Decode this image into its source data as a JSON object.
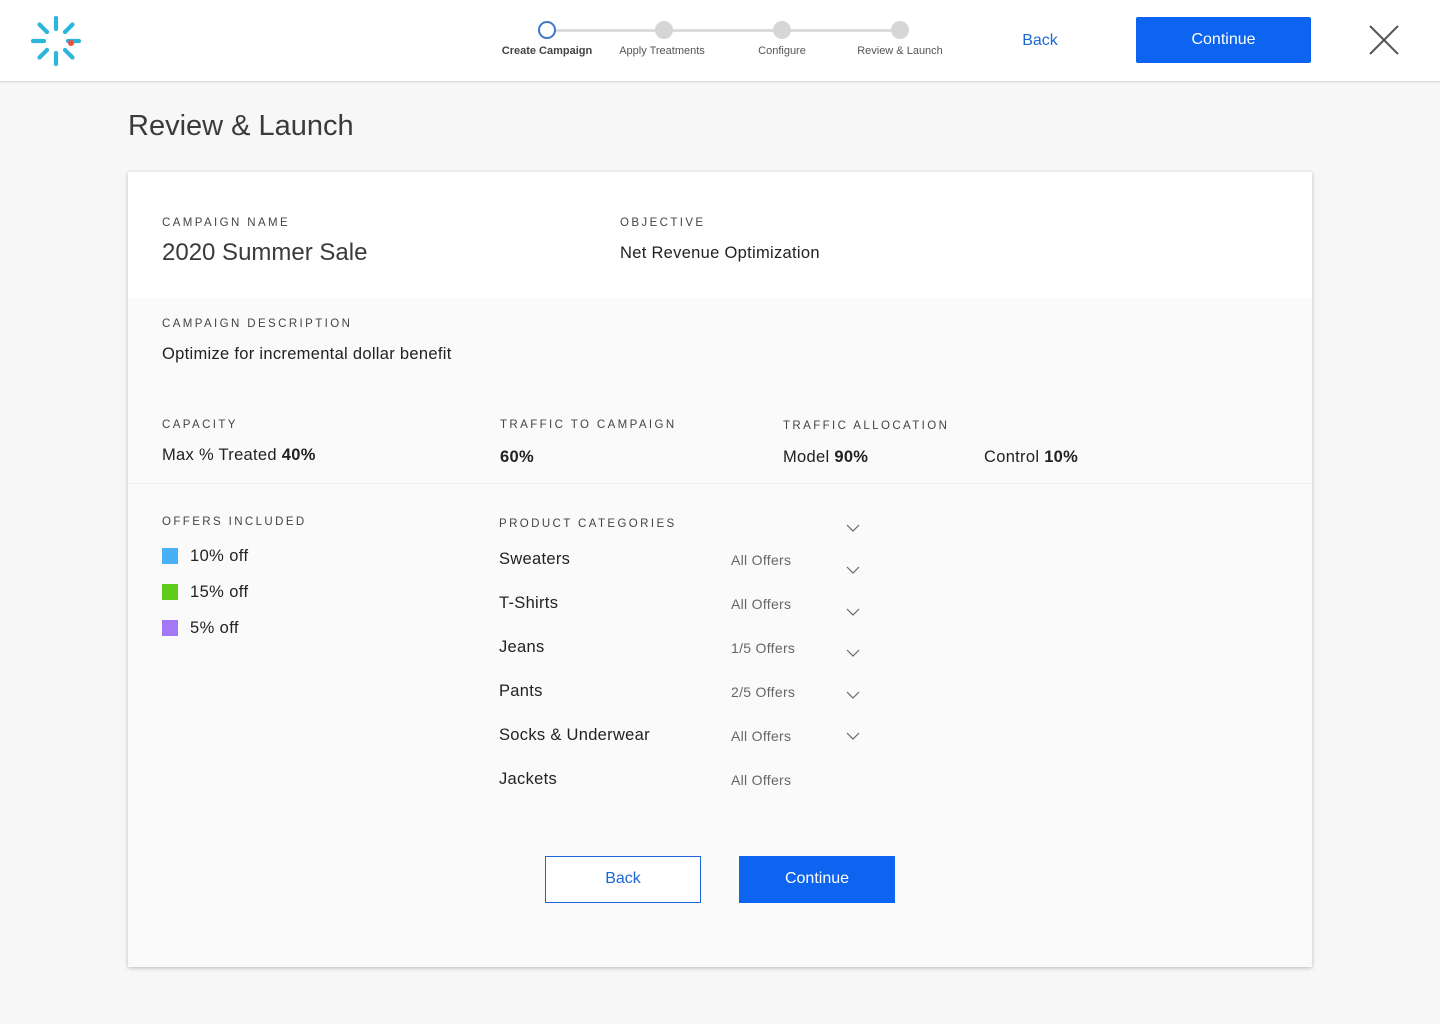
{
  "header": {
    "steps": [
      {
        "label": "Create Campaign",
        "active": true
      },
      {
        "label": "Apply Treatments",
        "active": false
      },
      {
        "label": "Configure",
        "active": false
      },
      {
        "label": "Review & Launch",
        "active": false
      }
    ],
    "back_label": "Back",
    "continue_label": "Continue"
  },
  "page": {
    "title": "Review & Launch"
  },
  "campaign": {
    "name_label": "CAMPAIGN NAME",
    "name": "2020 Summer Sale",
    "objective_label": "OBJECTIVE",
    "objective": "Net Revenue Optimization",
    "description_label": "CAMPAIGN DESCRIPTION",
    "description": "Optimize for incremental dollar benefit",
    "capacity_label": "CAPACITY",
    "capacity_text": "Max % Treated",
    "capacity_value": "40%",
    "traffic_label": "TRAFFIC TO CAMPAIGN",
    "traffic_value": "60%",
    "allocation_label": "TRAFFIC ALLOCATION",
    "model_text": "Model",
    "model_value": "90%",
    "control_text": "Control",
    "control_value": "10%"
  },
  "offers": {
    "label": "OFFERS INCLUDED",
    "items": [
      {
        "label": "10% off",
        "color": "#4ab0f5"
      },
      {
        "label": "15% off",
        "color": "#5fcb1a"
      },
      {
        "label": "5% off",
        "color": "#a478f5"
      }
    ]
  },
  "categories": {
    "label": "PRODUCT CATEGORIES",
    "items": [
      {
        "name": "Sweaters",
        "offers": "All Offers"
      },
      {
        "name": "T-Shirts",
        "offers": "All Offers"
      },
      {
        "name": "Jeans",
        "offers": "1/5 Offers"
      },
      {
        "name": "Pants",
        "offers": "2/5 Offers"
      },
      {
        "name": "Socks & Underwear",
        "offers": "All Offers"
      },
      {
        "name": "Jackets",
        "offers": "All Offers"
      }
    ]
  },
  "footer": {
    "back_label": "Back",
    "continue_label": "Continue"
  },
  "colors": {
    "accent": "#0d64f0",
    "link": "#1c67d6",
    "logo_primary": "#2eb5dc",
    "logo_dot": "#f04e3e"
  }
}
